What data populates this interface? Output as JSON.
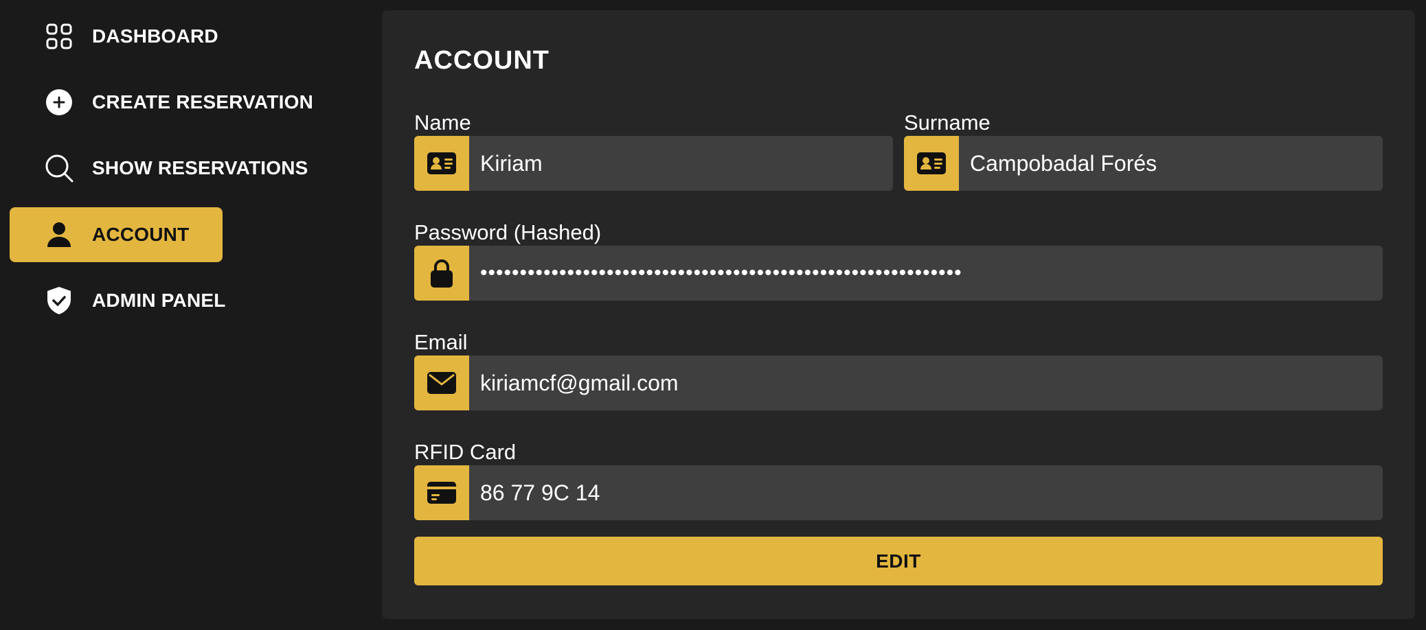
{
  "sidebar": {
    "items": [
      {
        "label": "DASHBOARD",
        "icon": "grid-icon"
      },
      {
        "label": "CREATE RESERVATION",
        "icon": "plus-circle-icon"
      },
      {
        "label": "SHOW RESERVATIONS",
        "icon": "search-icon"
      },
      {
        "label": "ACCOUNT",
        "icon": "user-icon",
        "active": true
      },
      {
        "label": "ADMIN PANEL",
        "icon": "shield-check-icon"
      }
    ]
  },
  "account": {
    "title": "ACCOUNT",
    "name": {
      "label": "Name",
      "value": "Kiriam",
      "icon": "id-card-icon"
    },
    "surname": {
      "label": "Surname",
      "value": "Campobadal Forés",
      "icon": "id-card-icon"
    },
    "password": {
      "label": "Password (Hashed)",
      "value": "•••••••••••••••••••••••••••••••••••••••••••••••••••••••••••••",
      "icon": "lock-icon"
    },
    "email": {
      "label": "Email",
      "value": "kiriamcf@gmail.com",
      "icon": "envelope-icon"
    },
    "rfid": {
      "label": "RFID Card",
      "value": "86 77 9C 14",
      "icon": "credit-card-icon"
    },
    "edit_label": "EDIT"
  },
  "colors": {
    "accent": "#e3b63f",
    "background": "#1a1a1a",
    "panel": "#262626",
    "field": "#3f3f3f"
  }
}
